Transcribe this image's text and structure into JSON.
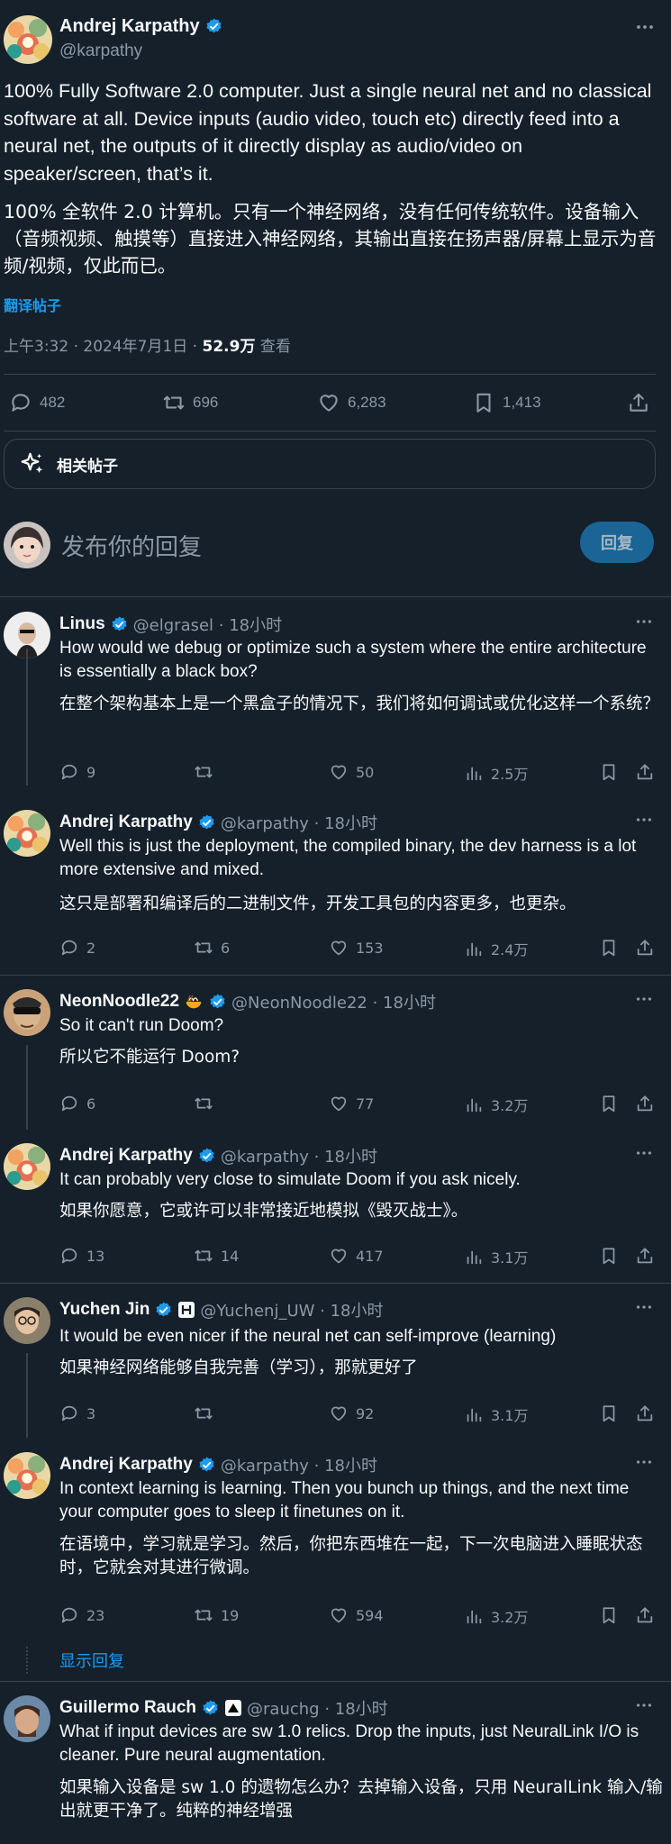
{
  "main_tweet": {
    "author_name": "Andrej Karpathy",
    "author_handle": "@karpathy",
    "text_en": "100% Fully Software 2.0 computer. Just a single neural net and no classical software at all. Device inputs (audio video, touch etc) directly feed into a neural net, the outputs of it directly display as audio/video on speaker/screen, that’s it.",
    "text_zh": "100% 全软件 2.0 计算机。只有一个神经网络，没有任何传统软件。设备输入（音频视频、触摸等）直接进入神经网络，其输出直接在扬声器/屏幕上显示为音频/视频，仅此而已。",
    "translate_label": "翻译帖子",
    "time": "上午3:32 · 2024年7月1日 · ",
    "views": "52.9万",
    "views_label": " 查看",
    "replies": "482",
    "retweets": "696",
    "likes": "6,283",
    "bookmarks": "1,413"
  },
  "related": {
    "label": "相关帖子"
  },
  "composer": {
    "placeholder": "发布你的回复",
    "button": "回复"
  },
  "replies": [
    {
      "name": "Linus",
      "handle": "@elgrasel · 18小时",
      "text_en": "How would we debug or optimize such a system where the entire architecture is essentially a black box?",
      "text_zh": "在整个架构基本上是一个黑盒子的情况下，我们将如何调试或优化这样一个系统？",
      "replies": "9",
      "retweets": "",
      "likes": "50",
      "views": "2.5万"
    },
    {
      "name": "Andrej Karpathy",
      "handle": "@karpathy · 18小时",
      "text_en": "Well this is just the deployment, the compiled binary, the dev harness is a lot more extensive and mixed.",
      "text_zh": "这只是部署和编译后的二进制文件，开发工具包的内容更多，也更杂。",
      "replies": "2",
      "retweets": "6",
      "likes": "153",
      "views": "2.4万"
    },
    {
      "name": "NeonNoodle22",
      "handle": "@NeonNoodle22 · 18小时",
      "text_en": "So it can't run Doom?",
      "text_zh": "所以它不能运行 Doom?",
      "replies": "6",
      "retweets": "",
      "likes": "77",
      "views": "3.2万"
    },
    {
      "name": "Andrej Karpathy",
      "handle": "@karpathy · 18小时",
      "text_en": "It can probably very close to simulate Doom if you ask nicely.",
      "text_zh": "如果你愿意，它或许可以非常接近地模拟《毁灭战士》。",
      "replies": "13",
      "retweets": "14",
      "likes": "417",
      "views": "3.1万"
    },
    {
      "name": "Yuchen Jin",
      "handle": "@Yuchenj_UW · 18小时",
      "text_en": "It would be even nicer if the neural net can self-improve (learning)",
      "text_zh": "如果神经网络能够自我完善（学习），那就更好了",
      "replies": "3",
      "retweets": "",
      "likes": "92",
      "views": "3.1万"
    },
    {
      "name": "Andrej Karpathy",
      "handle": "@karpathy · 18小时",
      "text_en": "In context learning is learning. Then you bunch up things, and the next time your computer goes to sleep it finetunes on it.",
      "text_zh": "在语境中，学习就是学习。然后，你把东西堆在一起，下一次电脑进入睡眠状态时，它就会对其进行微调。",
      "replies": "23",
      "retweets": "19",
      "likes": "594",
      "views": "3.2万"
    },
    {
      "name": "Guillermo Rauch",
      "handle": "@rauchg · 18小时",
      "text_en": "What if input devices are sw 1.0 relics. Drop the inputs, just NeuralLink I/O is cleaner. Pure neural augmentation.",
      "text_zh": "如果输入设备是 sw 1.0 的遗物怎么办？去掉输入设备，只用 NeuralLink 输入/输出就更干净了。纯粹的神经增强",
      "replies": "",
      "retweets": "",
      "likes": "",
      "views": ""
    }
  ],
  "show_replies_label": "显示回复",
  "colors": {
    "background": "#15202b",
    "accent": "#1d9bf0",
    "muted": "#8b98a5",
    "divider": "#38444d"
  }
}
